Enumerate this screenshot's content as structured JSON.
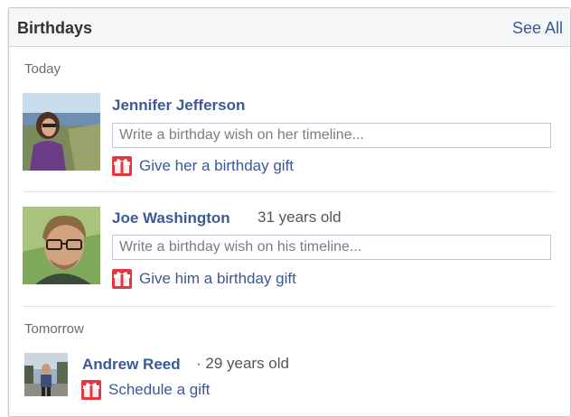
{
  "panel": {
    "title": "Birthdays",
    "see_all": "See All"
  },
  "sections": {
    "today": "Today",
    "tomorrow": "Tomorrow"
  },
  "people": [
    {
      "name": "Jennifer Jefferson",
      "age": "",
      "wish_placeholder": "Write a birthday wish on her timeline...",
      "gift_label": "Give her a birthday gift"
    },
    {
      "name": "Joe Washington",
      "age": "31 years old",
      "wish_placeholder": "Write a birthday wish on his timeline...",
      "gift_label": "Give him a birthday gift"
    },
    {
      "name": "Andrew Reed",
      "age": "· 29 years old",
      "gift_label": "Schedule a gift"
    }
  ],
  "icons": {
    "gift": "gift-icon"
  },
  "colors": {
    "link": "#3b5998",
    "gift": "#e0383e"
  }
}
